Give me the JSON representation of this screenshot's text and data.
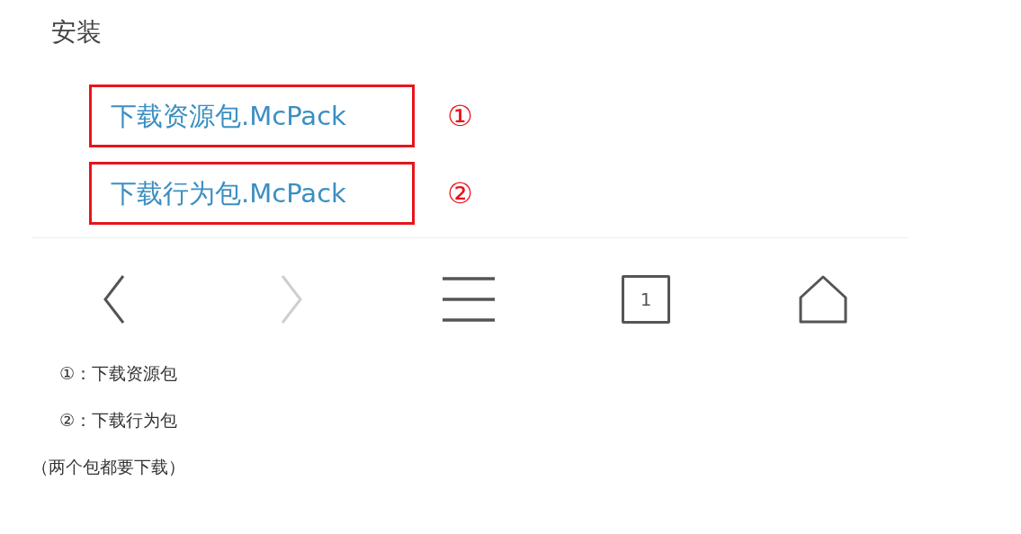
{
  "page_heading": "安装",
  "links": [
    {
      "label": "下载资源包.McPack",
      "marker": "①"
    },
    {
      "label": "下载行为包.McPack",
      "marker": "②"
    }
  ],
  "nav_bar": {
    "buttons": [
      {
        "kind": "back",
        "disabled": false
      },
      {
        "kind": "forward",
        "disabled": true
      },
      {
        "kind": "menu",
        "disabled": false
      },
      {
        "kind": "tabs",
        "disabled": false,
        "count": "1"
      },
      {
        "kind": "home",
        "disabled": false
      }
    ]
  },
  "notes": [
    "①：下载资源包",
    "②：下载行为包",
    "（两个包都要下载）"
  ]
}
